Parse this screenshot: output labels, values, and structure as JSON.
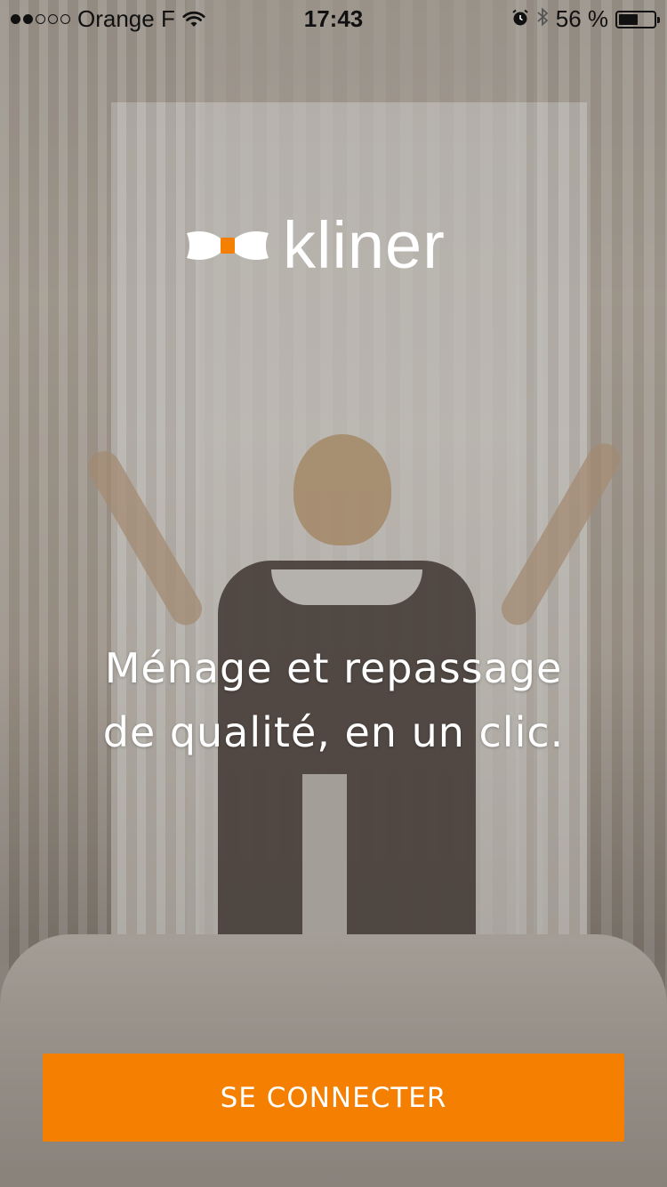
{
  "status_bar": {
    "carrier": "Orange F",
    "signal_bars_filled": 2,
    "signal_bars_total": 5,
    "time": "17:43",
    "battery_text": "56 %",
    "battery_level": 0.56,
    "icons": [
      "wifi-icon",
      "alarm-icon",
      "bluetooth-icon",
      "battery-icon"
    ]
  },
  "brand": {
    "name": "kliner",
    "accent_color": "#f47f00"
  },
  "hero": {
    "tagline_line1": "Ménage et repassage",
    "tagline_line2": "de qualité, en un clic."
  },
  "actions": {
    "login_label": "SE CONNECTER"
  }
}
